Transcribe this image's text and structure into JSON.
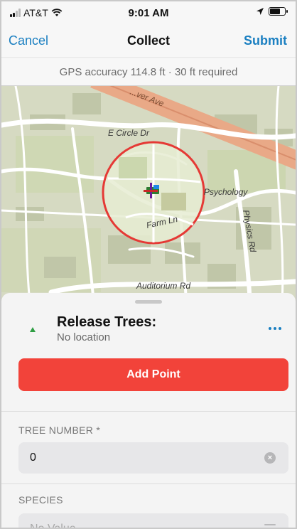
{
  "status_bar": {
    "carrier": "AT&T",
    "time": "9:01 AM"
  },
  "nav": {
    "cancel_label": "Cancel",
    "title": "Collect",
    "submit_label": "Submit"
  },
  "gps": {
    "text": "GPS accuracy 114.8 ft · 30 ft required"
  },
  "map": {
    "labels": {
      "top_avenue": "...ver Ave",
      "circle_drive": "E Circle Dr",
      "farm_lane": "Farm Ln",
      "psychology": "Psychology",
      "physics_road": "Physics Rd",
      "auditorium_road": "Auditorium Rd"
    },
    "accuracy_circle_color": "#e53935"
  },
  "sheet": {
    "layer_title": "Release Trees:",
    "location_status": "No location",
    "add_point_label": "Add Point",
    "fields": [
      {
        "label": "TREE NUMBER *",
        "value": "0"
      },
      {
        "label": "SPECIES",
        "placeholder": "No Value"
      }
    ]
  },
  "colors": {
    "accent": "#1a7fc1",
    "add_button": "#f2433a"
  }
}
